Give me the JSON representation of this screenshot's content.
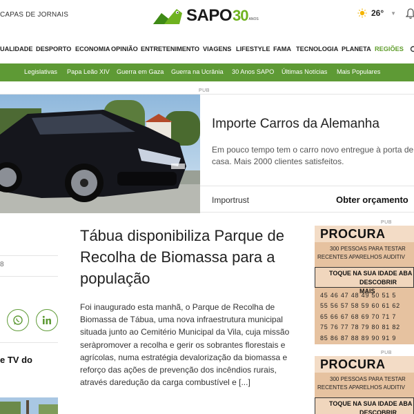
{
  "header": {
    "capas_link": "CAPAS DE JORNAIS",
    "logo_text": "SAPO",
    "logo_30": "30",
    "logo_anos": "ANOS",
    "temperature": "26°"
  },
  "nav": {
    "items": [
      "UALIDADE",
      "DESPORTO",
      "ECONOMIA",
      "OPINIÃO",
      "ENTRETENIMENTO",
      "VIAGENS",
      "LIFESTYLE",
      "FAMA",
      "TECNOLOGIA",
      "PLANETA",
      "REGIÕES"
    ],
    "active_index": 10
  },
  "subnav": {
    "items": [
      "Legislativas",
      "Papa Leão XIV",
      "Guerra em Gaza",
      "Guerra na Ucrânia",
      "30 Anos SAPO",
      "Últimas Notícias",
      "Mais Populares"
    ]
  },
  "ad": {
    "pub_label": "PUB",
    "title": "Importe Carros da Alemanha",
    "description": "Em pouco tempo tem o carro novo entregue à porta de casa. Mais 2000 clientes satisfeitos.",
    "brand": "Importrust",
    "cta": "Obter orçamento"
  },
  "left_column": {
    "date_fragment": "8",
    "tv_fragment": "e TV do"
  },
  "article": {
    "title": "Tábua disponibiliza Parque de Recolha de Biomassa para a população",
    "body": "Foi inaugurado esta manhã, o Parque de Recolha de Biomassa de Tábua, uma nova infraestrutura municipal situada junto ao Cemitério Municipal da Vila, cuja missão seràpromover a recolha e gerir os sobrantes florestais e agrícolas, numa estratégia devalorização da biomassa e reforço das ações de prevenção dos incêndios rurais, através daredução da carga combustível e [...]"
  },
  "side_ads": [
    {
      "pub_label": "PUB",
      "headline": "PROCURA",
      "line1": "300 PESSOAS PARA TESTAR",
      "line2": "RECENTES APARELHOS AUDITIV",
      "box_line1": "TOQUE NA SUA IDADE ABA",
      "box_line2": "DESCOBRIR MAIS",
      "numbers": [
        "45 46 47 48 49 50 51 5",
        "55 56 57 58 59 60 61 62",
        "65 66 67 68 69 70 71 7",
        "75 76 77 78 79 80 81 82",
        "85 86 87 88 89 90 91 9"
      ]
    },
    {
      "pub_label": "PUB",
      "headline": "PROCURA",
      "line1": "300 PESSOAS PARA TESTAR",
      "line2": "RECENTES APARELHOS AUDITIV",
      "box_line1": "TOQUE NA SUA IDADE ABA",
      "box_line2": "DESCOBRIR MAIS"
    }
  ],
  "colors": {
    "brand_green": "#5e9a35",
    "logo_green": "#6fb21f"
  }
}
